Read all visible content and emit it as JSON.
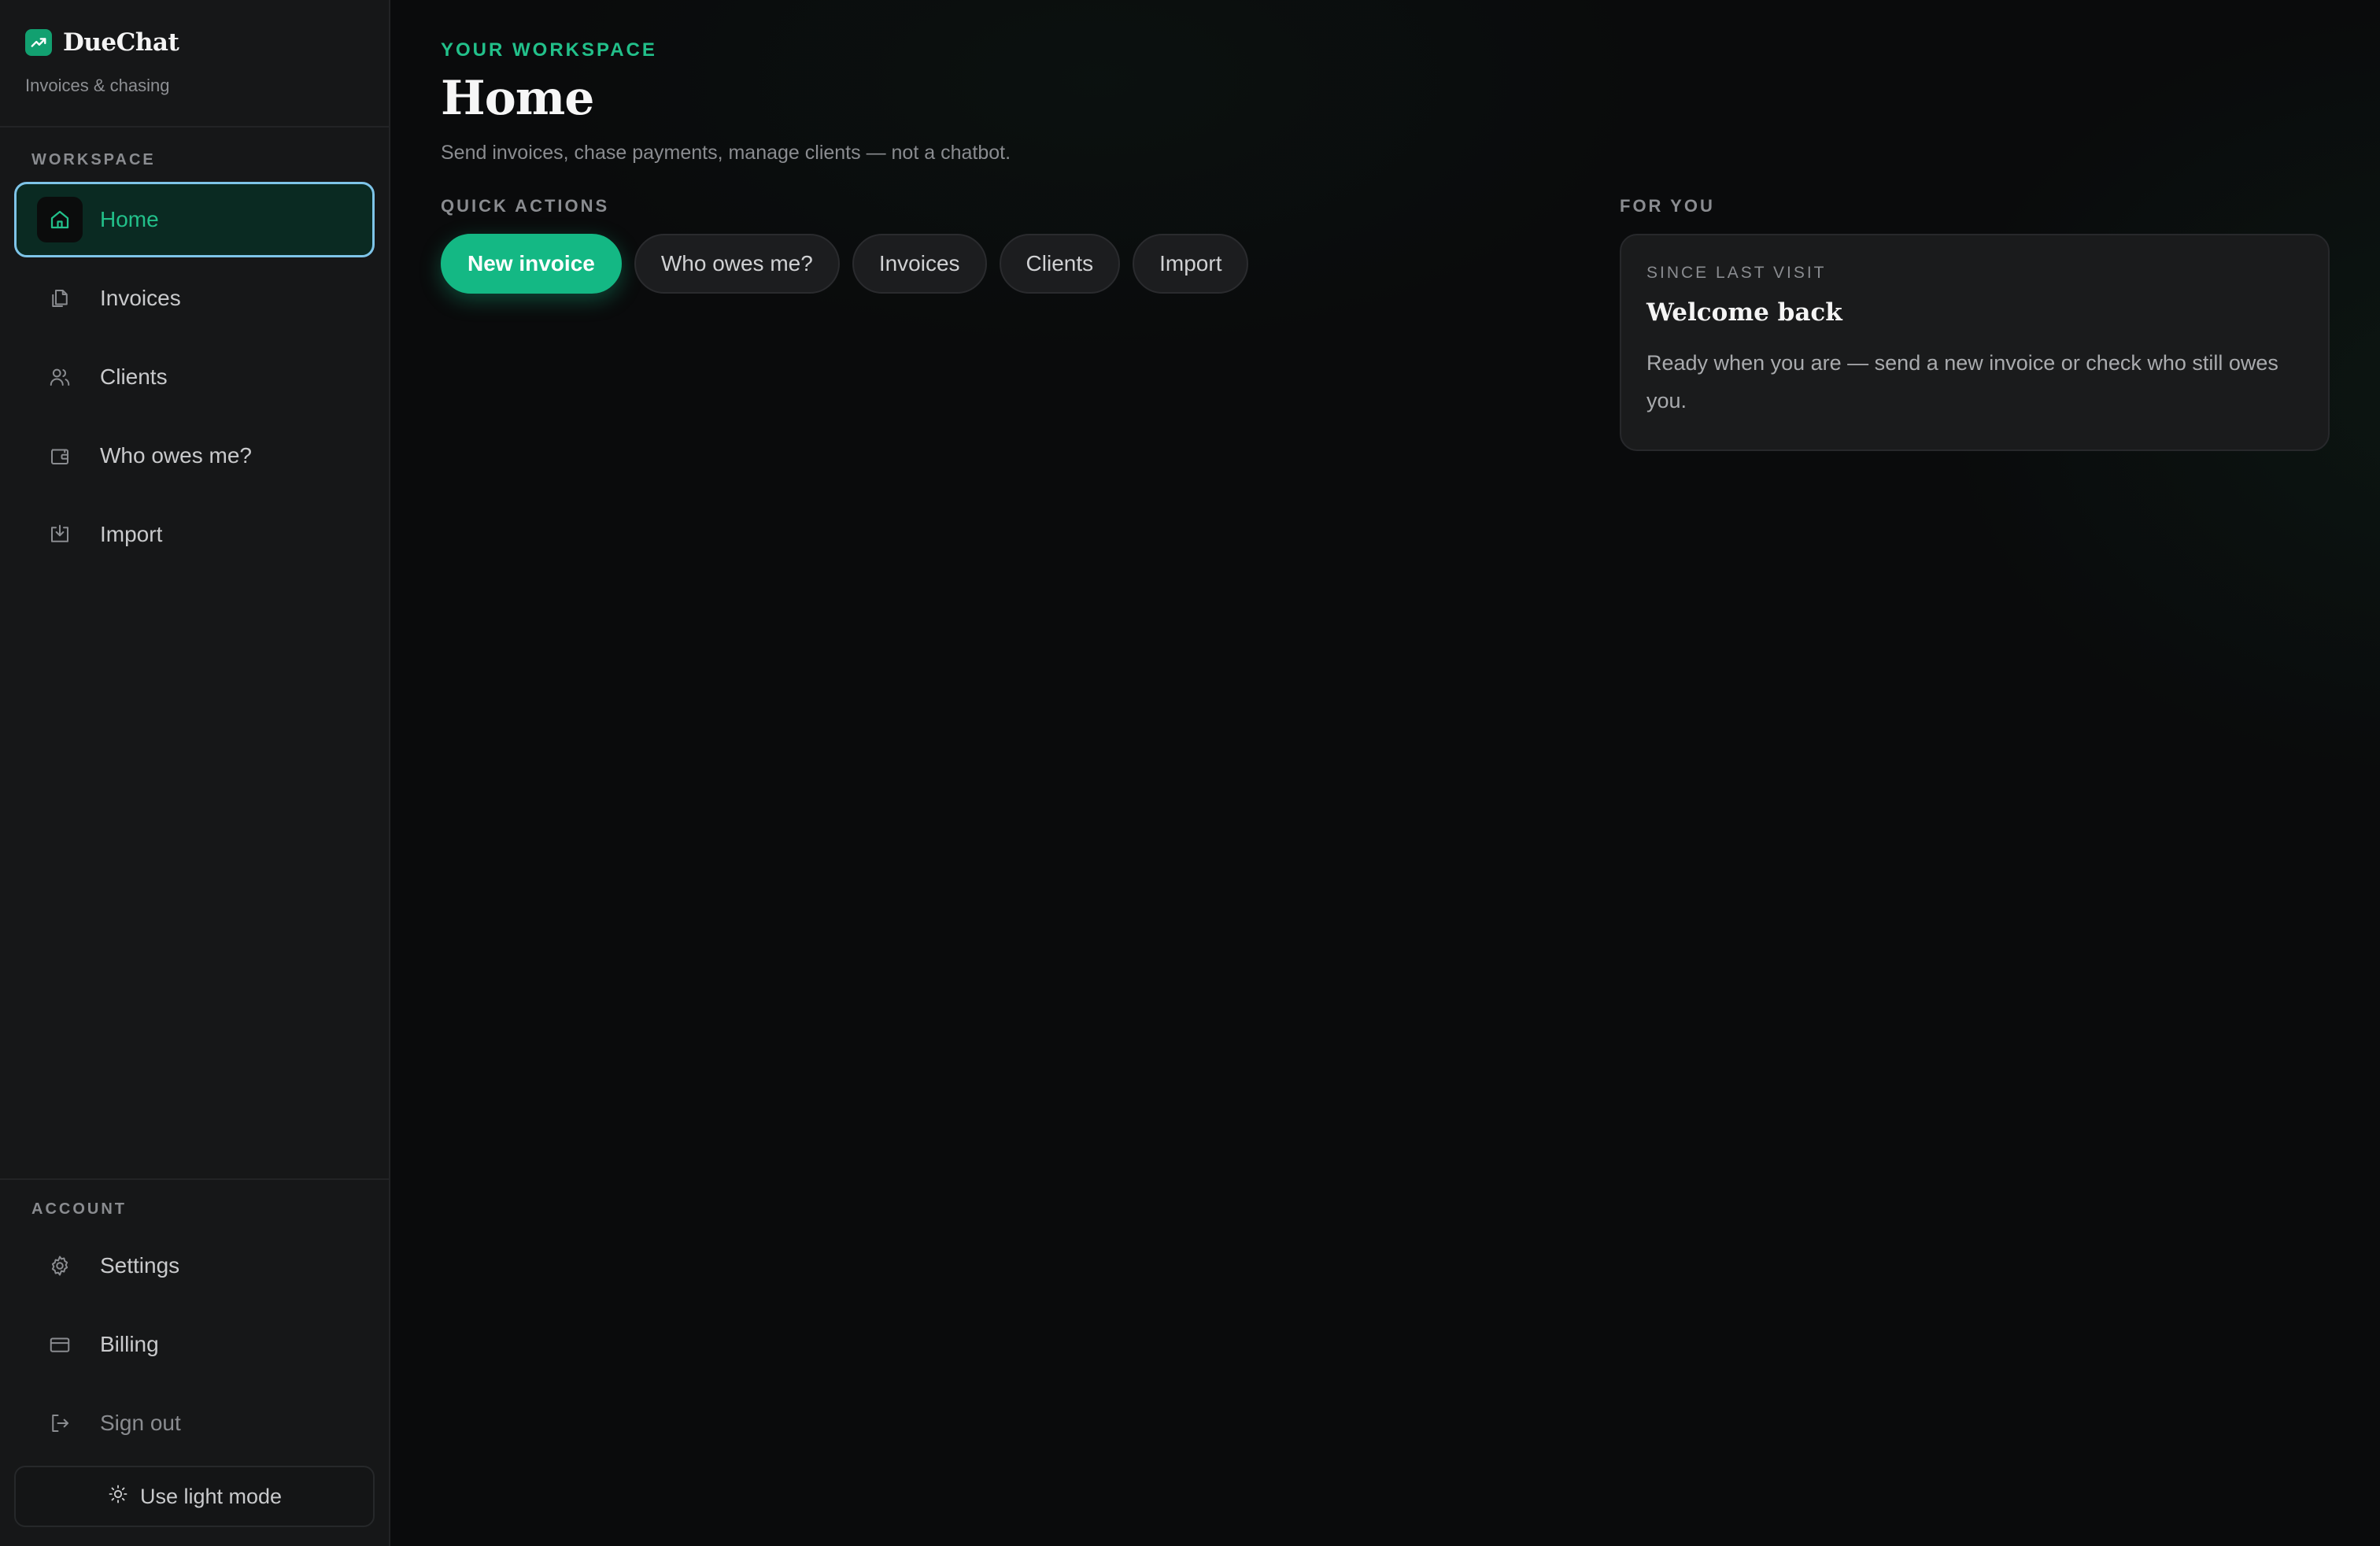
{
  "brand": {
    "name": "DueChat",
    "subtitle": "Invoices & chasing"
  },
  "sidebar": {
    "workspace_label": "WORKSPACE",
    "items": [
      {
        "label": "Home",
        "icon": "home-icon",
        "active": true
      },
      {
        "label": "Invoices",
        "icon": "documents-icon",
        "active": false
      },
      {
        "label": "Clients",
        "icon": "users-icon",
        "active": false
      },
      {
        "label": "Who owes me?",
        "icon": "wallet-icon",
        "active": false
      },
      {
        "label": "Import",
        "icon": "import-icon",
        "active": false
      }
    ],
    "account_label": "ACCOUNT",
    "account_items": [
      {
        "label": "Settings",
        "icon": "gear-icon"
      },
      {
        "label": "Billing",
        "icon": "credit-card-icon"
      },
      {
        "label": "Sign out",
        "icon": "sign-out-icon"
      }
    ],
    "theme_toggle": {
      "label": "Use light mode",
      "icon": "sun-icon"
    }
  },
  "main": {
    "eyebrow": "YOUR WORKSPACE",
    "title": "Home",
    "description": "Send invoices, chase payments, manage clients — not a chatbot.",
    "quick_actions_label": "QUICK ACTIONS",
    "quick_actions": [
      "New invoice",
      "Who owes me?",
      "Invoices",
      "Clients",
      "Import"
    ],
    "for_you_label": "FOR YOU",
    "card": {
      "eyebrow": "SINCE LAST VISIT",
      "title": "Welcome back",
      "body": "Ready when you are — send a new invoice or check who still owes you."
    }
  },
  "colors": {
    "accent": "#14b884",
    "accent_text": "#22c08a",
    "active_border": "#7ec4e8",
    "sidebar_bg": "#161718",
    "main_bg": "#0a0b0c"
  }
}
